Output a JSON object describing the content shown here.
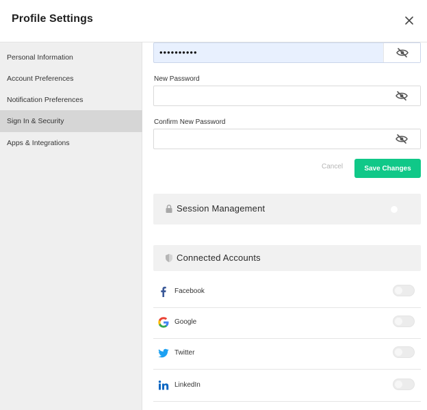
{
  "header": {
    "title": "Profile Settings"
  },
  "sidebar": {
    "items": [
      {
        "label": "Personal Information"
      },
      {
        "label": "Account Preferences"
      },
      {
        "label": "Notification Preferences"
      },
      {
        "label": "Sign In & Security",
        "active": true
      },
      {
        "label": "Apps & Integrations"
      }
    ]
  },
  "password_form": {
    "current_password_value": "••••••••••",
    "new_password_label": "New Password",
    "confirm_password_label": "Confirm New Password",
    "cancel_label": "Cancel",
    "save_label": "Save Changes"
  },
  "sections": {
    "session_management": "Session Management",
    "connected_accounts": "Connected Accounts"
  },
  "connected_accounts": [
    {
      "name": "Facebook",
      "icon": "facebook-icon",
      "enabled": false
    },
    {
      "name": "Google",
      "icon": "google-icon",
      "enabled": false
    },
    {
      "name": "Twitter",
      "icon": "twitter-icon",
      "enabled": false
    },
    {
      "name": "LinkedIn",
      "icon": "linkedin-icon",
      "enabled": false
    }
  ],
  "colors": {
    "accent": "#10c888",
    "sidebar_bg": "#efefef",
    "sidebar_active": "#d6d6d6",
    "autofill_bg": "#e8f0fe",
    "facebook": "#3b5998",
    "twitter": "#1da1f2",
    "linkedin": "#0a66c2"
  }
}
